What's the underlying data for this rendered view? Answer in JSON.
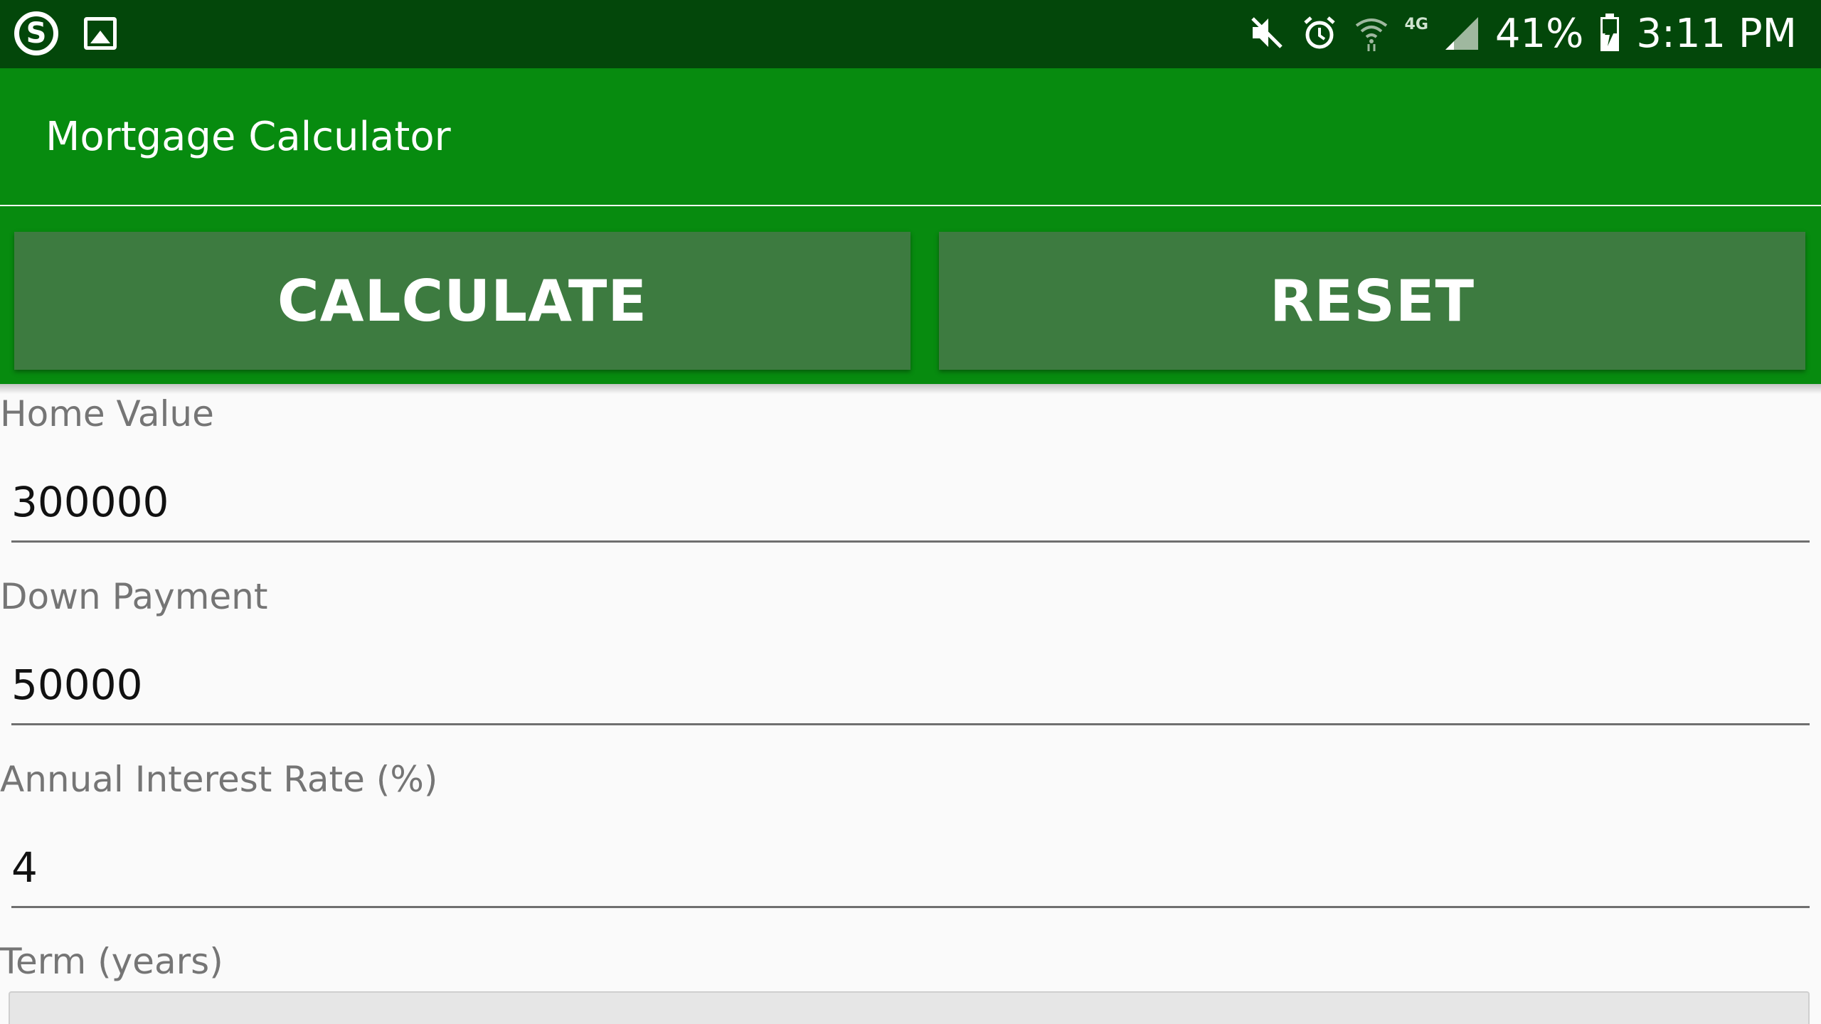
{
  "status_bar": {
    "left_icons": [
      "skype-icon",
      "gallery-icon"
    ],
    "right_icons": [
      "mute-icon",
      "alarm-icon",
      "wifi-icon",
      "signal-icon",
      "battery-charging-icon"
    ],
    "network": "4G",
    "battery": "41%",
    "time": "3:11 PM",
    "skype_glyph": "S"
  },
  "app_bar": {
    "title": "Mortgage Calculator"
  },
  "actions": {
    "calculate_label": "CALCULATE",
    "reset_label": "RESET"
  },
  "form": {
    "home_value": {
      "label": "Home Value",
      "value": "300000"
    },
    "down_payment": {
      "label": "Down Payment",
      "value": "50000"
    },
    "interest_rate": {
      "label": "Annual Interest Rate (%)",
      "value": "4"
    },
    "term": {
      "label": "Term (years)"
    }
  },
  "colors": {
    "status_bar": "#03470a",
    "app_bar": "#078b0f",
    "button": "#3d7b40",
    "background": "#fafafa"
  }
}
